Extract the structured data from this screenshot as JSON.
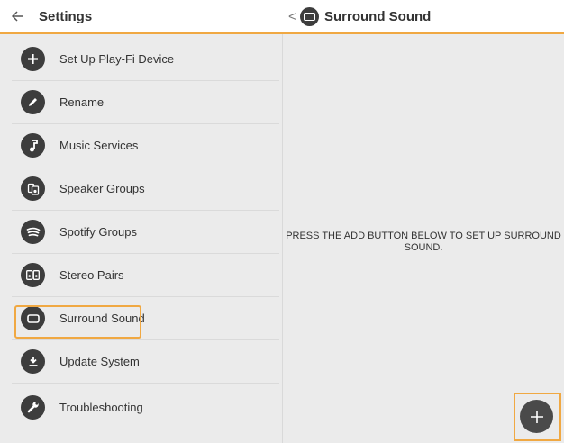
{
  "header": {
    "left_title": "Settings",
    "detail_back": "<",
    "detail_title": "Surround Sound"
  },
  "sidebar": {
    "items": [
      {
        "label": "Set Up Play-Fi Device",
        "icon": "plus-icon"
      },
      {
        "label": "Rename",
        "icon": "pencil-icon"
      },
      {
        "label": "Music Services",
        "icon": "music-note-icon"
      },
      {
        "label": "Speaker Groups",
        "icon": "speaker-groups-icon"
      },
      {
        "label": "Spotify Groups",
        "icon": "spotify-icon"
      },
      {
        "label": "Stereo Pairs",
        "icon": "stereo-pairs-icon"
      },
      {
        "label": "Surround Sound",
        "icon": "surround-sound-icon",
        "selected": true
      },
      {
        "label": "Update System",
        "icon": "download-icon"
      },
      {
        "label": "Troubleshooting",
        "icon": "wrench-icon"
      }
    ]
  },
  "detail": {
    "message": "PRESS THE ADD BUTTON BELOW TO SET UP SURROUND SOUND.",
    "add_button_icon": "plus-icon"
  },
  "colors": {
    "accent": "#f0a842",
    "icon_bg": "#3d3d3d",
    "panel_bg": "#ebebeb"
  }
}
